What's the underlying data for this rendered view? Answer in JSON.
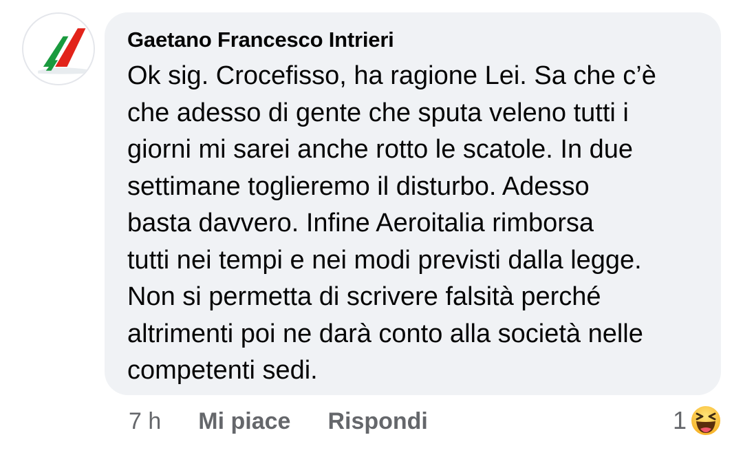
{
  "comment": {
    "author": "Gaetano Francesco Intrieri",
    "avatar_icon": "aeroitalia-logo-icon",
    "text_lines": [
      "Ok sig. Crocefisso, ha ragione Lei. Sa che c’è",
      "che adesso di gente che sputa veleno tutti i",
      "giorni mi sarei anche rotto le scatole. In due",
      "settimane toglieremo il disturbo. Adesso",
      "basta davvero. Infine Aeroitalia rimborsa",
      "tutti nei tempi e nei modi previsti dalla legge.",
      "Non si permetta di scrivere falsità perché",
      "altrimenti poi ne darà conto alla società nelle",
      "competenti sedi."
    ],
    "bubble_color": "#f0f2f5"
  },
  "actions": {
    "time": "7 h",
    "like_label": "Mi piace",
    "reply_label": "Rispondi"
  },
  "reactions": {
    "count": "1",
    "icon": "haha-emoji-icon"
  },
  "colors": {
    "text": "#050505",
    "secondary": "#65676b",
    "logo_red": "#e2231a",
    "logo_green": "#1a9a3e"
  }
}
